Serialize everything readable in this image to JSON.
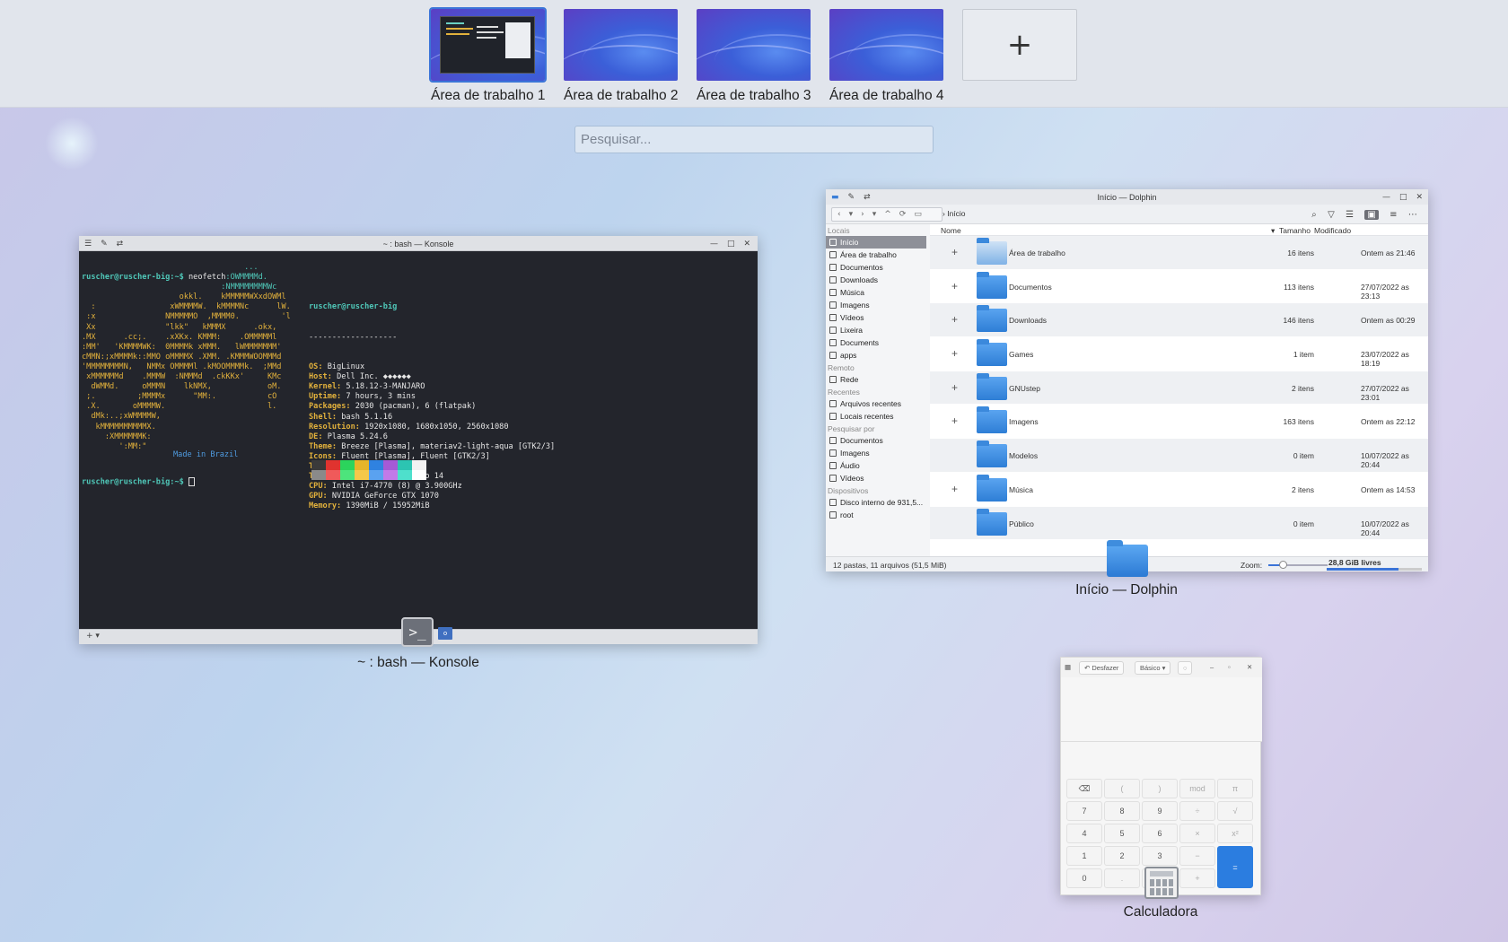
{
  "desktops": [
    {
      "label": "Área de trabalho 1",
      "active": true
    },
    {
      "label": "Área de trabalho 2",
      "active": false
    },
    {
      "label": "Área de trabalho 3",
      "active": false
    },
    {
      "label": "Área de trabalho 4",
      "active": false
    }
  ],
  "add_desktop_label": "+",
  "search": {
    "placeholder": "Pesquisar..."
  },
  "konsole": {
    "title": "~ : bash — Konsole",
    "caption": "~ : bash — Konsole",
    "prompt": "ruscher@ruscher-big:~$",
    "command": " neofetch",
    "user_host": "ruscher@ruscher-big",
    "separator": "-------------------",
    "info": [
      {
        "k": "OS",
        "v": " BigLinux"
      },
      {
        "k": "Host",
        "v": " Dell Inc. ◆◆◆◆◆◆"
      },
      {
        "k": "Kernel",
        "v": " 5.18.12-3-MANJARO"
      },
      {
        "k": "Uptime",
        "v": " 7 hours, 3 mins"
      },
      {
        "k": "Packages",
        "v": " 2030 (pacman), 6 (flatpak)"
      },
      {
        "k": "Shell",
        "v": " bash 5.1.16"
      },
      {
        "k": "Resolution",
        "v": " 1920x1080, 1680x1050, 2560x1080"
      },
      {
        "k": "DE",
        "v": " Plasma 5.24.6"
      },
      {
        "k": "Theme",
        "v": " Breeze [Plasma], materiav2-light-aqua [GTK2/3]"
      },
      {
        "k": "Icons",
        "v": " Fluent [Plasma], Fluent [GTK2/3]"
      },
      {
        "k": "Terminal",
        "v": " konsole"
      },
      {
        "k": "Terminal Font",
        "v": " Ubuntu Mono 14"
      },
      {
        "k": "CPU",
        "v": " Intel i7-4770 (8) @ 3.900GHz"
      },
      {
        "k": "GPU",
        "v": " NVIDIA GeForce GTX 1070"
      },
      {
        "k": "Memory",
        "v": " 1390MiB / 15952MiB"
      }
    ],
    "ascii": [
      "                                   ...",
      "                               :OWMMMMd.",
      "                              :NMMMMMMMMWc",
      "                     okkl.    kMMMMMWXxdOWMl",
      "  :                xWMMMMW.  kMMMMNc      lW.",
      " :x               NMMMMMO  ,MMMM0.         'l",
      " Xx               \"lkk\"   kMMMX      .okx,",
      ".MX      .cc;.    .xXKx. KMMM:    .OMMMMMl",
      ":MM'   'KMMMMWK:  0MMMMk xMMM.   lWMMMMMMM'",
      "cMMN:;xMMMMk::MMO oMMMMX .XMM. .KMMMWOOMMMd",
      "'MMMMMMMMN,   NMMx OMMMMl .kMOOMMMMk.  ;MMd",
      " xMMMMMMd    .MMMW  :NMMMd  .ckKKx'     KMc",
      "  dWMMd.     oMMMN    lkNMX,            oM.",
      " ;.         ;MMMMx      \"MM:.           cO",
      " .X.       oMMMMW.                      l.",
      "  dMk:..;xWMMMMW,",
      "   kMMMMMMMMMMX.",
      "     :XMMMMMMK:",
      "        ':MM:\""
    ],
    "made_in": "Made in Brazil",
    "palette": [
      "#3a3a3a",
      "#e0332f",
      "#2bd45c",
      "#e6b52a",
      "#2f82e0",
      "#a55ad6",
      "#2cc4b2",
      "#f2f2f2",
      "#8a8a8a",
      "#f05a5a",
      "#4de47c",
      "#f5c84a",
      "#5aa2f0",
      "#c27ae8",
      "#4ee0cc",
      "#ffffff"
    ],
    "bottom_left": "+ ▾"
  },
  "dolphin": {
    "title": "Início — Dolphin",
    "caption": "Início — Dolphin",
    "breadcrumb": "Início",
    "sidebar": [
      {
        "type": "sec",
        "label": "Locais"
      },
      {
        "type": "it",
        "label": "Início",
        "sel": true
      },
      {
        "type": "it",
        "label": "Área de trabalho"
      },
      {
        "type": "it",
        "label": "Documentos"
      },
      {
        "type": "it",
        "label": "Downloads"
      },
      {
        "type": "it",
        "label": "Música"
      },
      {
        "type": "it",
        "label": "Imagens"
      },
      {
        "type": "it",
        "label": "Vídeos"
      },
      {
        "type": "it",
        "label": "Lixeira"
      },
      {
        "type": "it",
        "label": "Documents"
      },
      {
        "type": "it",
        "label": "apps"
      },
      {
        "type": "sec",
        "label": "Remoto"
      },
      {
        "type": "it",
        "label": "Rede"
      },
      {
        "type": "sec",
        "label": "Recentes"
      },
      {
        "type": "it",
        "label": "Arquivos recentes"
      },
      {
        "type": "it",
        "label": "Locais recentes"
      },
      {
        "type": "sec",
        "label": "Pesquisar por"
      },
      {
        "type": "it",
        "label": "Documentos"
      },
      {
        "type": "it",
        "label": "Imagens"
      },
      {
        "type": "it",
        "label": "Áudio"
      },
      {
        "type": "it",
        "label": "Vídeos"
      },
      {
        "type": "sec",
        "label": "Dispositivos"
      },
      {
        "type": "it",
        "label": "Disco interno de 931,5..."
      },
      {
        "type": "it",
        "label": "root"
      }
    ],
    "columns": {
      "name": "Nome",
      "size": "Tamanho",
      "modified": "Modificado"
    },
    "files": [
      {
        "name": "Área de trabalho",
        "size": "16 itens",
        "date": "Ontem as 21:46",
        "plus": true,
        "desk": true
      },
      {
        "name": "Documentos",
        "size": "113 itens",
        "date": "27/07/2022 as 23:13",
        "plus": true
      },
      {
        "name": "Downloads",
        "size": "146 itens",
        "date": "Ontem as 00:29",
        "plus": true
      },
      {
        "name": "Games",
        "size": "1 item",
        "date": "23/07/2022 as 18:19",
        "plus": true
      },
      {
        "name": "GNUstep",
        "size": "2 itens",
        "date": "27/07/2022 as 23:01",
        "plus": true
      },
      {
        "name": "Imagens",
        "size": "163 itens",
        "date": "Ontem as 22:12",
        "plus": true
      },
      {
        "name": "Modelos",
        "size": "0 item",
        "date": "10/07/2022 as 20:44",
        "plus": false
      },
      {
        "name": "Música",
        "size": "2 itens",
        "date": "Ontem as 14:53",
        "plus": true
      },
      {
        "name": "Público",
        "size": "0 item",
        "date": "10/07/2022 as 20:44",
        "plus": false
      }
    ],
    "status": "12 pastas, 11 arquivos (51,5 MiB)",
    "zoom_label": "Zoom:",
    "free": "28,8 GiB livres"
  },
  "calculator": {
    "caption": "Calculadora",
    "undo": "↶ Desfazer",
    "mode": "Básico ▾",
    "keys": [
      "⌫",
      "(",
      ")",
      "mod",
      "π",
      "7",
      "8",
      "9",
      "÷",
      "√",
      "4",
      "5",
      "6",
      "×",
      "x²",
      "1",
      "2",
      "3",
      "−",
      "0",
      ".",
      "%",
      "+"
    ],
    "equals": "="
  }
}
